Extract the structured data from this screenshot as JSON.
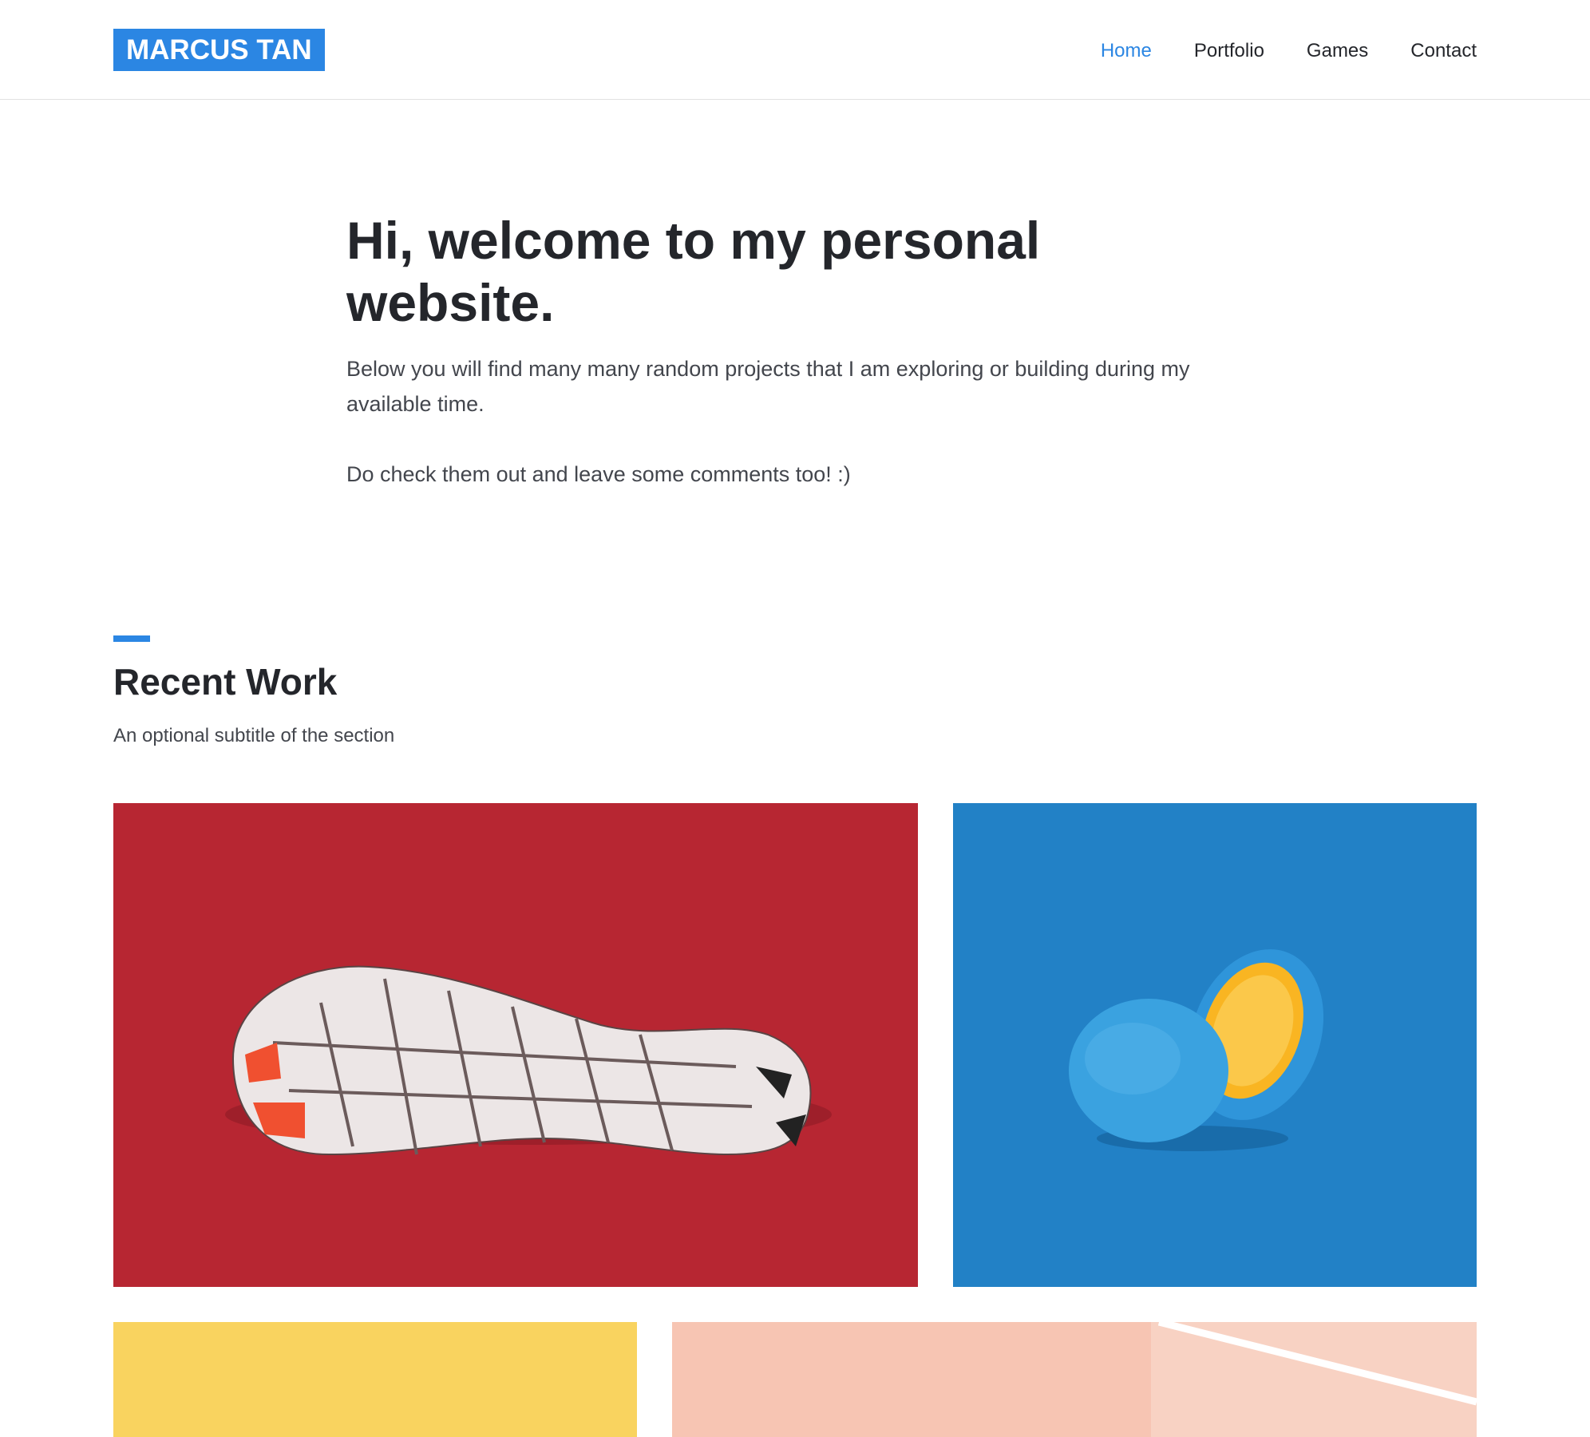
{
  "header": {
    "logo_text": "MARCUS TAN",
    "nav": [
      {
        "label": "Home",
        "active": true
      },
      {
        "label": "Portfolio",
        "active": false
      },
      {
        "label": "Games",
        "active": false
      },
      {
        "label": "Contact",
        "active": false
      }
    ]
  },
  "hero": {
    "title": "Hi, welcome to my personal website.",
    "paragraph_1": "Below you will find many many random projects that I am exploring or building during my available time.",
    "paragraph_2": "Do check them out and leave some comments too! :)"
  },
  "recent_work": {
    "title": "Recent Work",
    "subtitle": "An optional subtitle of the section",
    "items": [
      {
        "name": "sneaker-sole-on-red",
        "bg_color": "#b72632"
      },
      {
        "name": "blue-painted-orange",
        "bg_color": "#2281c6"
      },
      {
        "name": "yellow-tile",
        "bg_color": "#f9d35f"
      },
      {
        "name": "peach-court-tile",
        "bg_color": "#f7c5b3"
      }
    ]
  },
  "colors": {
    "accent": "#2b86e3",
    "text": "#24262b",
    "muted_text": "#43464d"
  }
}
